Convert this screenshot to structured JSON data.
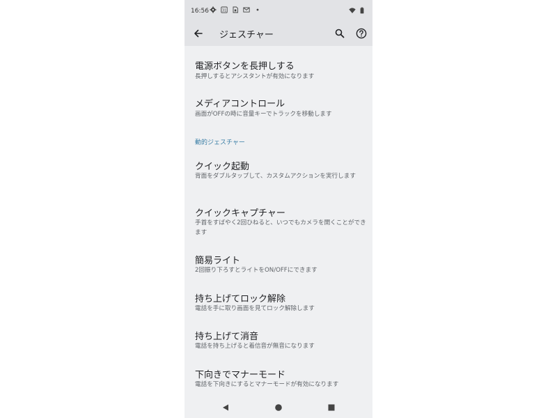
{
  "status_bar": {
    "time": "16:56",
    "left_icons": [
      "gear-icon",
      "calendar-icon",
      "sim-icon",
      "gmail-icon",
      "dot-icon"
    ],
    "right_icons": [
      "wifi-icon",
      "battery-icon"
    ],
    "calendar_day": "31"
  },
  "app_bar": {
    "title": "ジェスチャー",
    "back_icon": "arrow-back-icon",
    "search_icon": "search-icon",
    "help_icon": "help-icon"
  },
  "items_top": [
    {
      "title": "電源ボタンを長押しする",
      "subtitle": "長押しするとアシスタントが有効になります"
    },
    {
      "title": "メディアコントロール",
      "subtitle": "画面がOFFの時に音量キーでトラックを移動します"
    }
  ],
  "section": {
    "header": "動的ジェスチャー"
  },
  "items_dynamic": [
    {
      "title": "クイック起動",
      "subtitle": "背面をダブルタップして、カスタムアクションを実行します"
    },
    {
      "title": "クイックキャプチャー",
      "subtitle": "手首をすばやく2回ひねると、いつでもカメラを開くことができます"
    },
    {
      "title": "簡易ライト",
      "subtitle": "2回振り下ろすとライトをON/OFFにできます"
    },
    {
      "title": "持ち上げてロック解除",
      "subtitle": "電話を手に取り画面を見てロック解除します"
    },
    {
      "title": "持ち上げて消音",
      "subtitle": "電話を持ち上げると着信音が無音になります"
    },
    {
      "title": "下向きでマナーモード",
      "subtitle": "電話を下向きにするとマナーモードが有効になります"
    }
  ],
  "nav_bar": {
    "icons": [
      "nav-back-icon",
      "nav-home-icon",
      "nav-recents-icon"
    ]
  },
  "colors": {
    "background": "#eff0f2",
    "app_bar": "#e2e3e6",
    "section_header": "#3a7ea6",
    "title_text": "#202124",
    "subtitle_text": "#5f6368"
  }
}
